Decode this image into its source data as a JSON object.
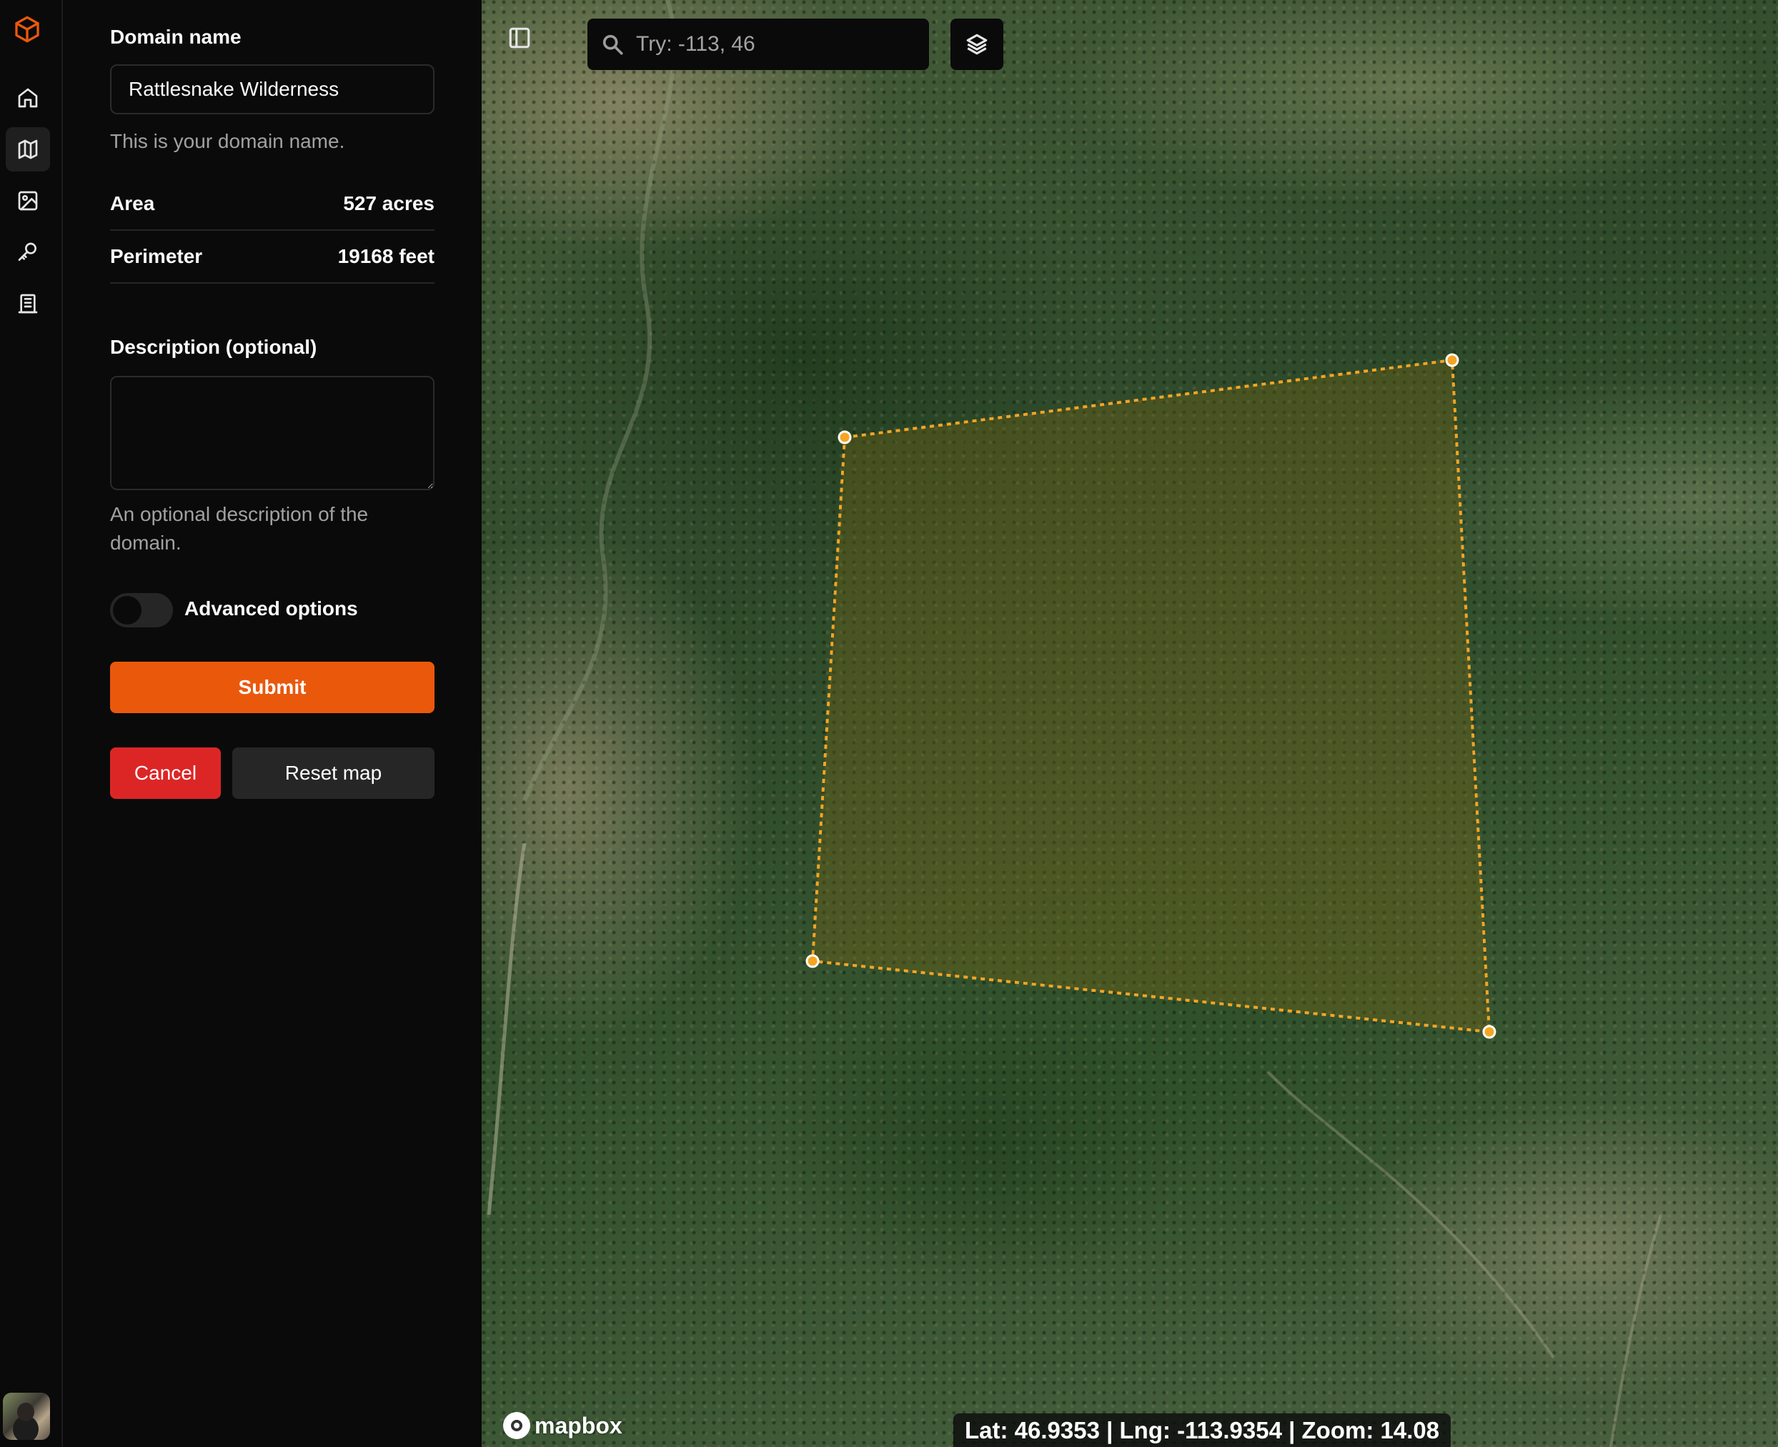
{
  "rail": {
    "logo_icon": "cube-logo-icon",
    "brand_color": "#ea580c",
    "items": [
      {
        "icon": "home-icon"
      },
      {
        "icon": "map-icon",
        "active": true
      },
      {
        "icon": "image-edit-icon"
      },
      {
        "icon": "key-icon"
      },
      {
        "icon": "building-icon"
      }
    ],
    "avatar": "user-avatar"
  },
  "form": {
    "domain_label": "Domain name",
    "domain_value": "Rattlesnake Wilderness",
    "domain_help": "This is your domain name.",
    "stats": [
      {
        "label": "Area",
        "value": "527 acres"
      },
      {
        "label": "Perimeter",
        "value": "19168 feet"
      }
    ],
    "description_label": "Description (optional)",
    "description_value": "",
    "description_help": "An optional description of the domain.",
    "advanced_label": "Advanced options",
    "advanced_enabled": false,
    "submit_label": "Submit",
    "cancel_label": "Cancel",
    "reset_label": "Reset map"
  },
  "colors": {
    "submit": "#ea580c",
    "cancel": "#dc2626",
    "polygon_stroke": "#f5a524",
    "polygon_fill": "rgba(120,100,20,0.35)"
  },
  "map": {
    "search_placeholder": "Try: -113, 46",
    "sidebar_toggle_icon": "panel-left-icon",
    "layers_icon": "layers-icon",
    "search_icon": "search-icon",
    "attribution": "mapbox",
    "coords": "Lat: 46.9353 | Lng: -113.9354 | Zoom: 14.08",
    "polygon_vertices": 4
  }
}
